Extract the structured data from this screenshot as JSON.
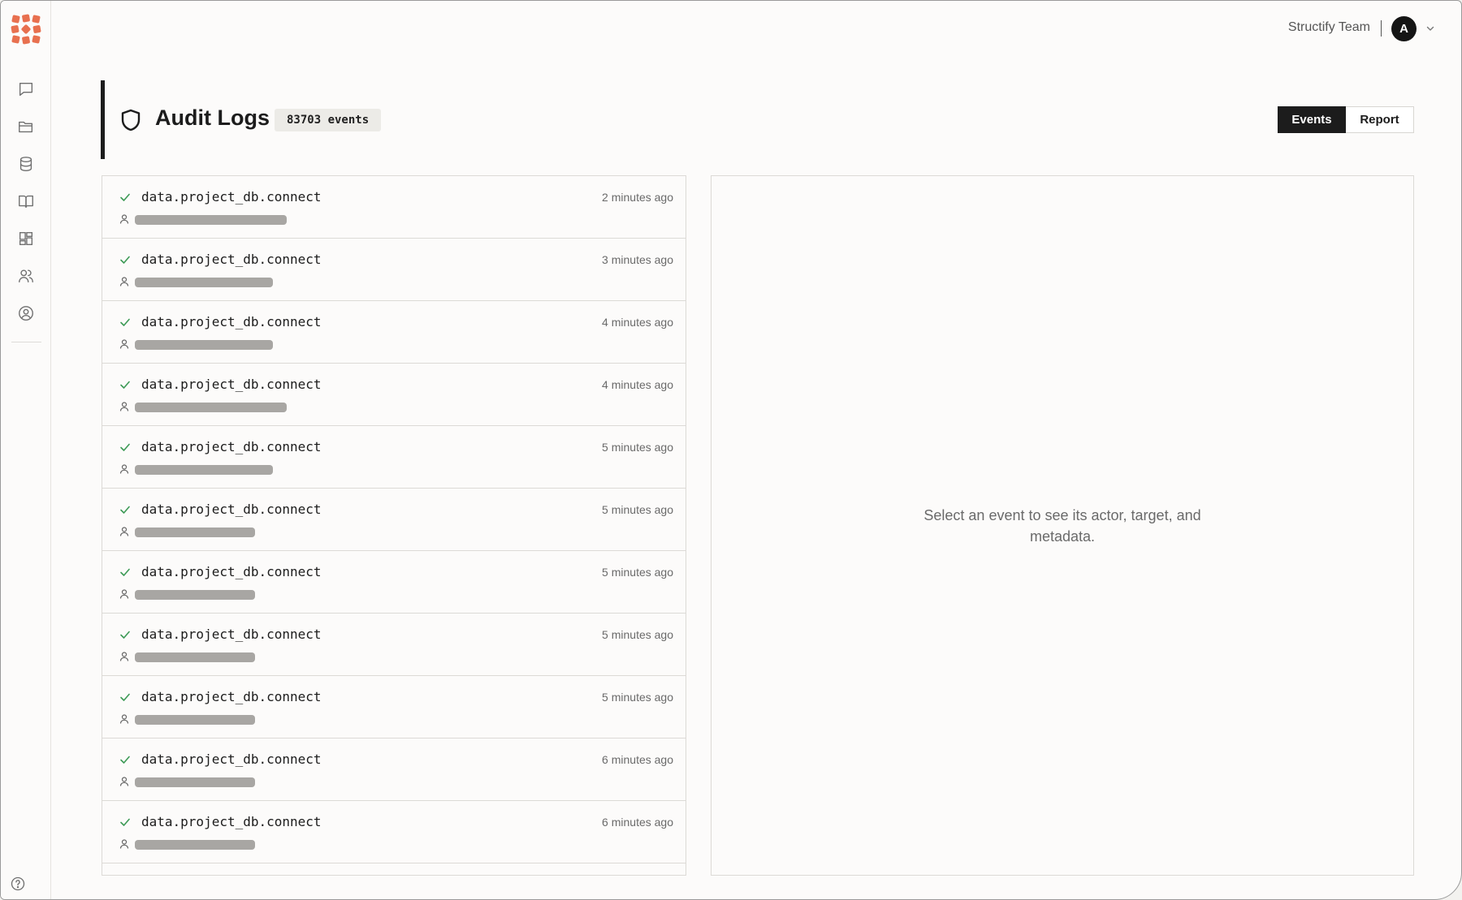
{
  "topbar": {
    "team_name": "Structify Team",
    "avatar_initial": "A"
  },
  "sidebar": {
    "items": [
      {
        "icon": "chat-icon",
        "name": "sidebar-item-chat"
      },
      {
        "icon": "folder-icon",
        "name": "sidebar-item-projects"
      },
      {
        "icon": "database-icon",
        "name": "sidebar-item-data"
      },
      {
        "icon": "book-icon",
        "name": "sidebar-item-docs"
      },
      {
        "icon": "dashboard-icon",
        "name": "sidebar-item-dashboard"
      },
      {
        "icon": "users-icon",
        "name": "sidebar-item-team"
      },
      {
        "icon": "user-circle-icon",
        "name": "sidebar-item-account"
      }
    ]
  },
  "header": {
    "title": "Audit Logs",
    "count_badge": "83703 events",
    "tabs": {
      "events": "Events",
      "report": "Report"
    }
  },
  "events": [
    {
      "name": "data.project_db.connect",
      "time": "2 minutes ago",
      "status": "success",
      "actor_redacted": true
    },
    {
      "name": "data.project_db.connect",
      "time": "3 minutes ago",
      "status": "success",
      "actor_redacted": true
    },
    {
      "name": "data.project_db.connect",
      "time": "4 minutes ago",
      "status": "success",
      "actor_redacted": true
    },
    {
      "name": "data.project_db.connect",
      "time": "4 minutes ago",
      "status": "success",
      "actor_redacted": true
    },
    {
      "name": "data.project_db.connect",
      "time": "5 minutes ago",
      "status": "success",
      "actor_redacted": true
    },
    {
      "name": "data.project_db.connect",
      "time": "5 minutes ago",
      "status": "success",
      "actor_redacted": true
    },
    {
      "name": "data.project_db.connect",
      "time": "5 minutes ago",
      "status": "success",
      "actor_redacted": true
    },
    {
      "name": "data.project_db.connect",
      "time": "5 minutes ago",
      "status": "success",
      "actor_redacted": true
    },
    {
      "name": "data.project_db.connect",
      "time": "5 minutes ago",
      "status": "success",
      "actor_redacted": true
    },
    {
      "name": "data.project_db.connect",
      "time": "6 minutes ago",
      "status": "success",
      "actor_redacted": true
    },
    {
      "name": "data.project_db.connect",
      "time": "6 minutes ago",
      "status": "success",
      "actor_redacted": true
    }
  ],
  "detail": {
    "empty_message": "Select an event to see its actor, target, and metadata."
  },
  "colors": {
    "accent_dark": "#1c1c1c",
    "success": "#3d9a56",
    "logo": "#e8704f",
    "redaction": "#a8a6a3"
  }
}
